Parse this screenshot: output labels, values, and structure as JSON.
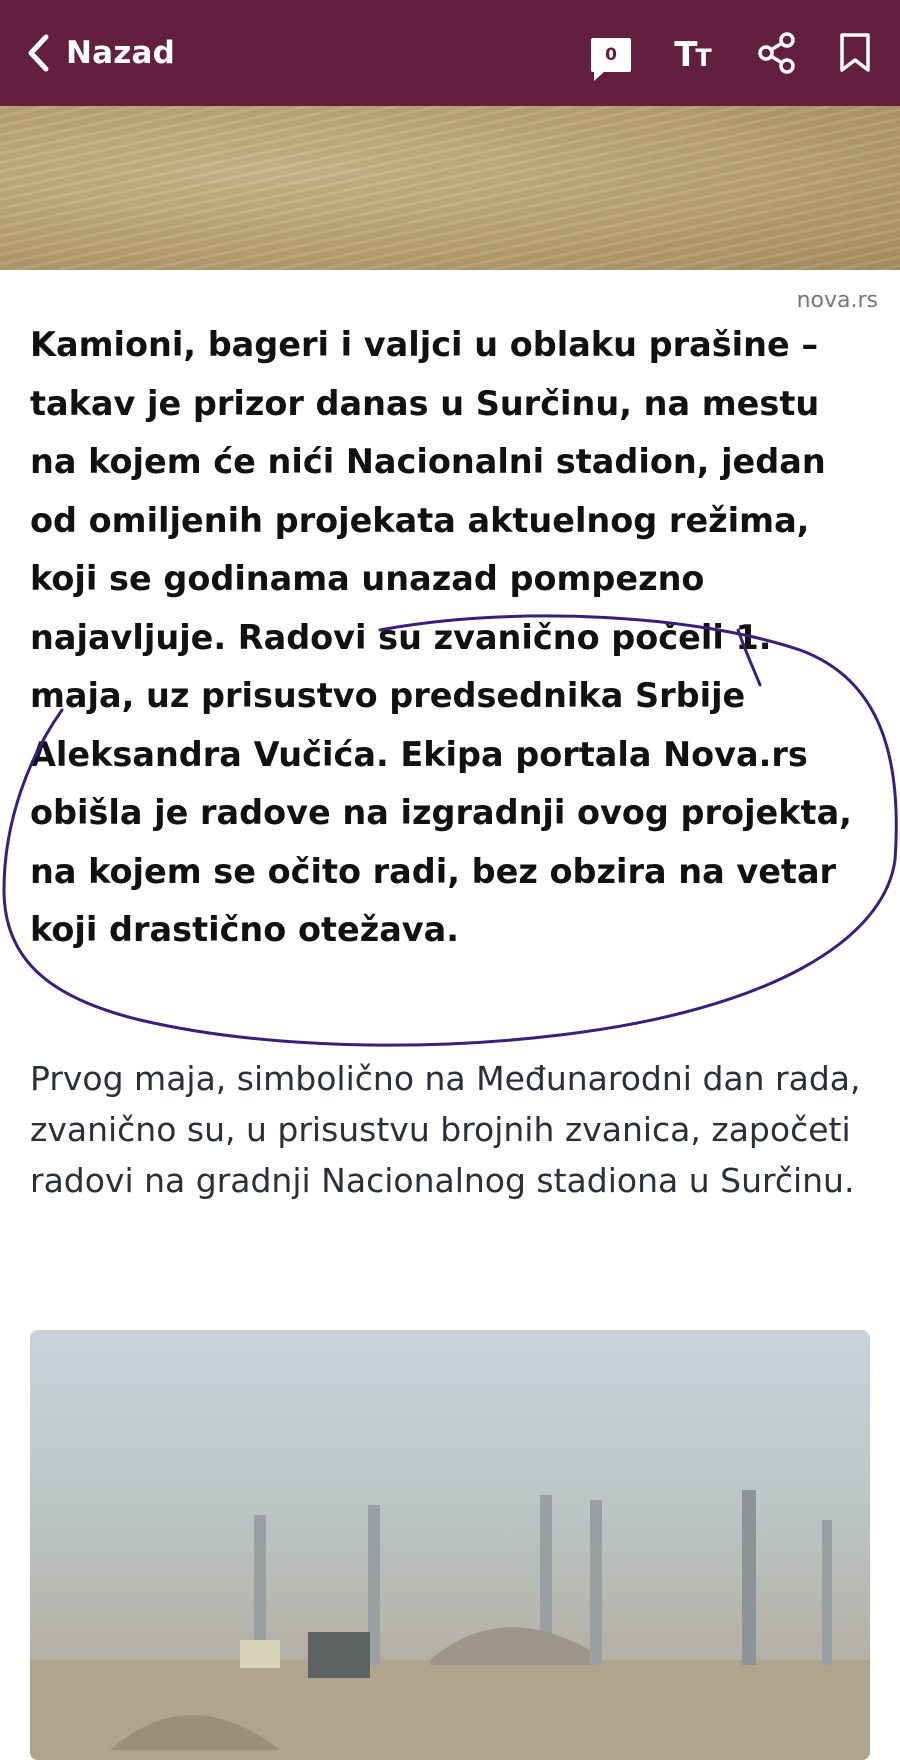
{
  "header": {
    "back_label": "Nazad",
    "comment_count": "0",
    "text_size_label": "TT",
    "bg_color": "#621f3e"
  },
  "article": {
    "photo_credit": "nova.rs",
    "lead": "Kamioni, bageri i valjci u oblaku prašine – takav je prizor danas u Surčinu, na mestu na kojem će nići Nacionalni stadion, jedan od omiljenih projekata aktuelnog režima, koji se godinama unazad pompezno najavljuje. Radovi su zvanično počeli 1. maja, uz prisustvo predsednika Srbije Aleksandra Vučića. Ekipa portala Nova.rs obišla je radove na izgradnji ovog projekta, na kojem se očito radi, bez obzira na vetar koji drastično otežava.",
    "body": "Prvog maja, simbolično na Međunarodni dan rada, zvanično su, u prisustvu brojnih zvanica, započeti radovi na gradnji Nacionalnog stadiona u Surčinu.",
    "annotation_color": "#3a1f7a"
  }
}
